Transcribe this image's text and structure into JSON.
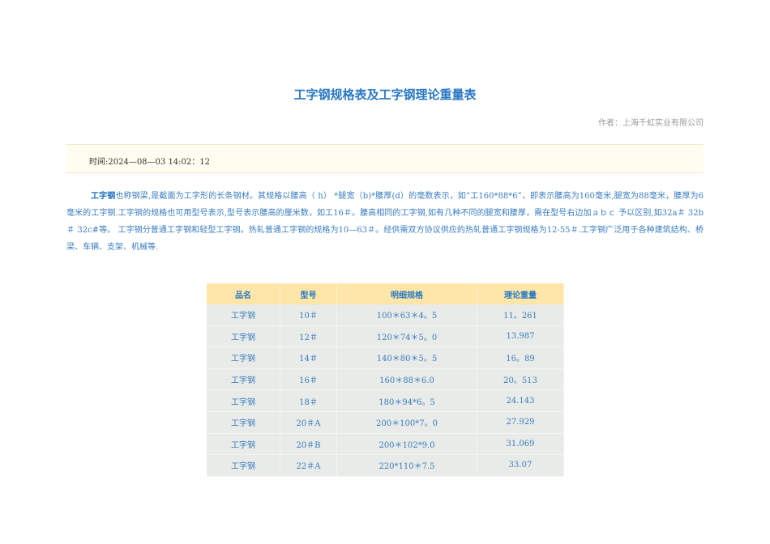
{
  "title": "工字钢规格表及工字钢理论重量表",
  "author": "作者：上海千虹实业有限公司",
  "time": "时间:2024—08—03  14:02：12",
  "intro": {
    "term": "工字钢",
    "text": "也称钢梁,是截面为工字形的长条钢材。其规格以腰高（ h） *腿宽（b)*腰厚(d）的毫数表示，如“工160*88*6”，即表示腰高为160毫米,腿宽为88毫米，腰厚为6毫米的工字钢.工字钢的规格也可用型号表示,型号表示腰高的厘米数，如工16＃。腰高相同的工字钢,如有几种不同的腿宽和腰厚，需在型号右边加ａｂｃ 予以区别,如32a＃ 32b＃ 32c#等。 工字钢分普通工字钢和轻型工字钢。热轧普通工字钢的规格为10—63＃。经供需双方协议供应的热轧普通工字钢规格为12-55＃.工字钢广泛用于各种建筑结构、桥梁、车辆、支架、机械等."
  },
  "table": {
    "headers": [
      "品名",
      "型号",
      "明细规格",
      "理论重量"
    ],
    "rows": [
      [
        "工字钢",
        "10＃",
        "100＊63＊4。5",
        "11。261"
      ],
      [
        "工字钢",
        "12＃",
        "120＊74＊5。0",
        "13.987"
      ],
      [
        "工字钢",
        "14＃",
        "140＊80＊5。5",
        "16。89"
      ],
      [
        "工字钢",
        "16＃",
        "160＊88＊6.0",
        "20。513"
      ],
      [
        "工字钢",
        "18＃",
        "180＊94*6。5",
        "24.143"
      ],
      [
        "工字钢",
        "20＃A",
        "200＊100*7。0",
        "27.929"
      ],
      [
        "工字钢",
        "20＃B",
        "200＊102*9.0",
        "31.069"
      ],
      [
        "工字钢",
        "22＃A",
        "220*110＊7.5",
        "33.07"
      ]
    ]
  }
}
